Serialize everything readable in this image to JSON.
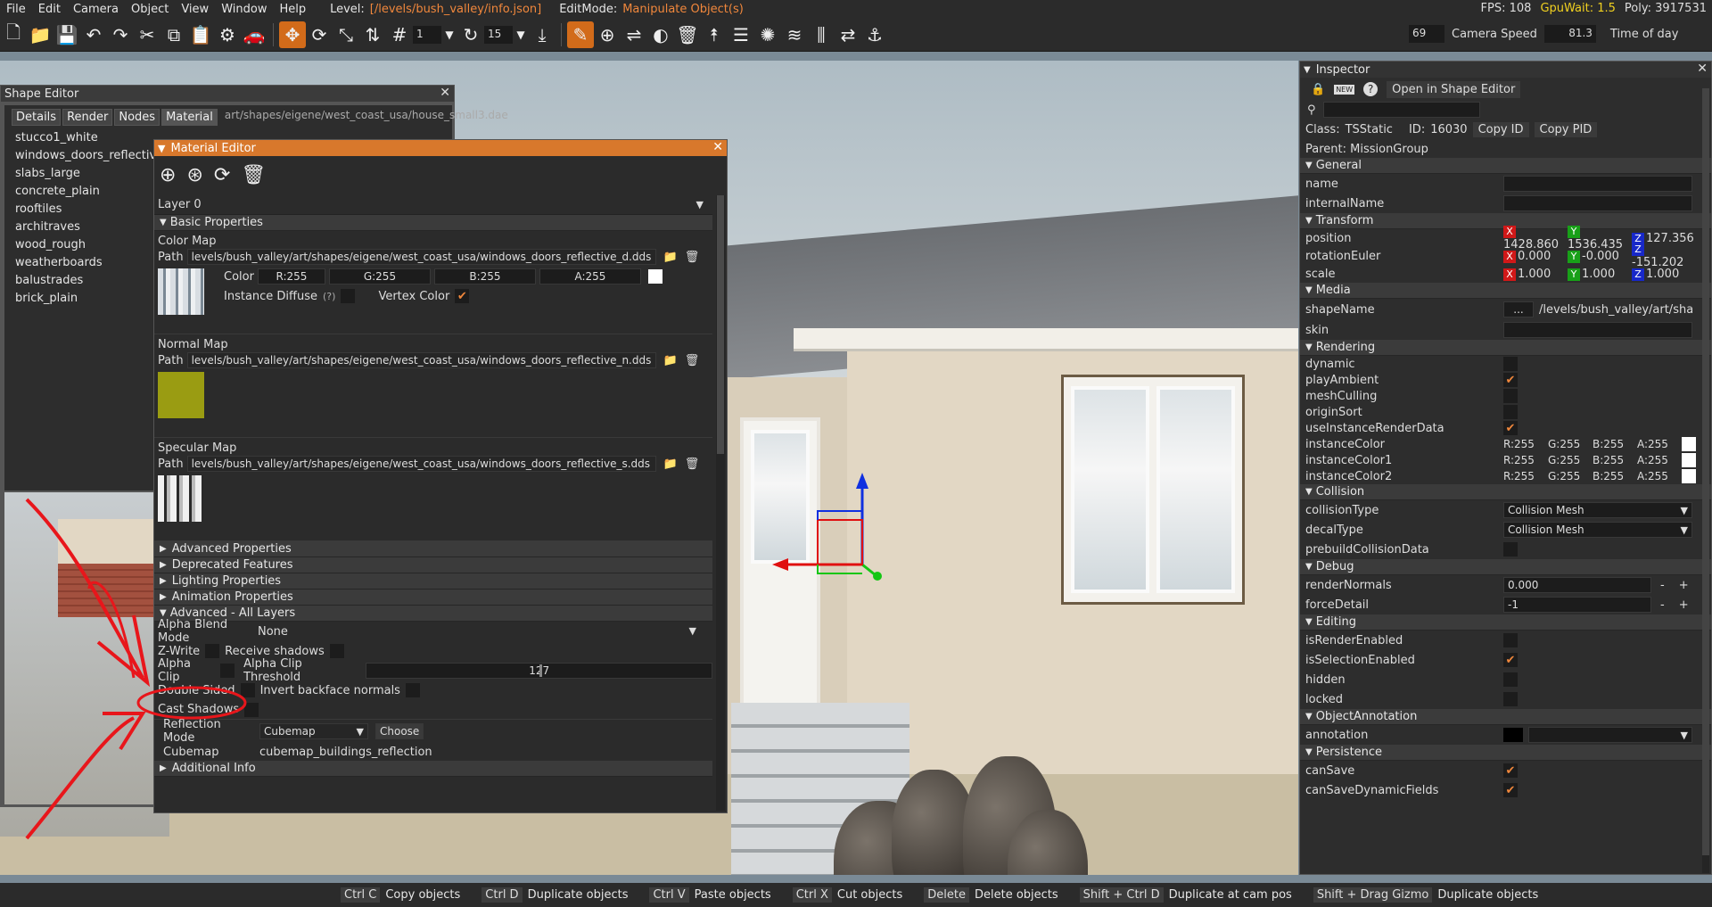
{
  "menubar": {
    "items": [
      "File",
      "Edit",
      "Camera",
      "Object",
      "View",
      "Window",
      "Help"
    ],
    "level_label": "Level:",
    "level_value": "[/levels/bush_valley/info.json]",
    "editmode_label": "EditMode:",
    "editmode_value": "Manipulate Object(s)",
    "fps": "FPS: 108",
    "gpuwait": "GpuWait: 1.5",
    "poly": "Poly: 3917531"
  },
  "toolbar": {
    "snap_value": "1",
    "rotate_value": "15",
    "fov_value": "69",
    "camera_speed_label": "Camera Speed",
    "camera_speed_value": "81.3",
    "time_of_day_label": "Time of day"
  },
  "shape_editor": {
    "title": "Shape Editor",
    "tabs": [
      "Details",
      "Render",
      "Nodes",
      "Material"
    ],
    "path": "art/shapes/eigene/west_coast_usa/house_small3.dae",
    "materials": [
      "stucco1_white",
      "windows_doors_reflective",
      "slabs_large",
      "concrete_plain",
      "rooftiles",
      "architraves",
      "wood_rough",
      "weatherboards",
      "balustrades",
      "brick_plain"
    ]
  },
  "material_editor": {
    "title": "Material Editor",
    "layer": "Layer 0",
    "basic_properties": "Basic Properties",
    "color_map": {
      "label": "Color Map",
      "path_label": "Path",
      "path": "levels/bush_valley/art/shapes/eigene/west_coast_usa/windows_doors_reflective_d.dds",
      "color_label": "Color",
      "r": "R:255",
      "g": "G:255",
      "b": "B:255",
      "a": "A:255",
      "instance_diffuse": "Instance Diffuse",
      "help": "(?)",
      "vertex_color": "Vertex Color"
    },
    "normal_map": {
      "label": "Normal Map",
      "path_label": "Path",
      "path": "levels/bush_valley/art/shapes/eigene/west_coast_usa/windows_doors_reflective_n.dds"
    },
    "specular_map": {
      "label": "Specular Map",
      "path_label": "Path",
      "path": "levels/bush_valley/art/shapes/eigene/west_coast_usa/windows_doors_reflective_s.dds"
    },
    "sections": [
      "Advanced Properties",
      "Deprecated Features",
      "Lighting Properties",
      "Animation Properties"
    ],
    "advanced_all_layers": "Advanced - All Layers",
    "alpha_blend_mode_label": "Alpha Blend Mode",
    "alpha_blend_mode_value": "None",
    "zwrite": "Z-Write",
    "receive_shadows": "Receive shadows",
    "alpha_clip": "Alpha Clip",
    "alpha_clip_threshold": "Alpha Clip Threshold",
    "alpha_clip_threshold_value": "127",
    "alpha_clip_threshold_level": 0.5,
    "double_sided": "Double Sided",
    "invert_backface": "Invert backface normals",
    "cast_shadows": "Cast Shadows",
    "reflection_mode_label": "Reflection Mode",
    "reflection_mode_value": "Cubemap",
    "choose": "Choose",
    "cubemap_label": "Cubemap",
    "cubemap_value": "cubemap_buildings_reflection",
    "additional_info": "Additional Info"
  },
  "inspector": {
    "title": "Inspector",
    "open_in_shape_editor": "Open in Shape Editor",
    "new_badge": "NEW",
    "class_label": "Class:",
    "class_value": "TSStatic",
    "id_label": "ID:",
    "id_value": "16030",
    "copy_id": "Copy ID",
    "copy_pid": "Copy PID",
    "parent": "Parent:  MissionGroup",
    "general": "General",
    "name": "name",
    "internal_name": "internalName",
    "transform": "Transform",
    "position": "position",
    "pos_x": "1428.860",
    "pos_y": "1536.435",
    "pos_z": "127.356",
    "rotation": "rotationEuler",
    "rot_x": "0.000",
    "rot_y": "-0.000",
    "rot_z": "-151.202",
    "scale": "scale",
    "scl_x": "1.000",
    "scl_y": "1.000",
    "scl_z": "1.000",
    "media": "Media",
    "shape_name": "shapeName",
    "shape_name_btn": "...",
    "shape_name_value": "/levels/bush_valley/art/shapes",
    "skin": "skin",
    "rendering": "Rendering",
    "render_fields": [
      {
        "label": "dynamic",
        "checked": false
      },
      {
        "label": "playAmbient",
        "checked": true
      },
      {
        "label": "meshCulling",
        "checked": false
      },
      {
        "label": "originSort",
        "checked": false
      },
      {
        "label": "useInstanceRenderData",
        "checked": true
      }
    ],
    "instance_colors": [
      "instanceColor",
      "instanceColor1",
      "instanceColor2"
    ],
    "ic_r": "R:255",
    "ic_g": "G:255",
    "ic_b": "B:255",
    "ic_a": "A:255",
    "collision": "Collision",
    "collision_type": "collisionType",
    "collision_type_value": "Collision Mesh",
    "decal_type": "decalType",
    "decal_type_value": "Collision Mesh",
    "prebuild": "prebuildCollisionData",
    "debug": "Debug",
    "render_normals": "renderNormals",
    "render_normals_value": "0.000",
    "force_detail": "forceDetail",
    "force_detail_value": "-1",
    "editing": "Editing",
    "editing_fields": [
      {
        "label": "isRenderEnabled",
        "checked": false
      },
      {
        "label": "isSelectionEnabled",
        "checked": true
      },
      {
        "label": "hidden",
        "checked": false
      },
      {
        "label": "locked",
        "checked": false
      }
    ],
    "object_annotation": "ObjectAnnotation",
    "annotation": "annotation",
    "persistence": "Persistence",
    "can_save": "canSave",
    "can_save_dynamic": "canSaveDynamicFields",
    "minus": "-",
    "plus": "+"
  },
  "statusbar": [
    {
      "key": "Ctrl C",
      "action": "Copy objects"
    },
    {
      "key": "Ctrl D",
      "action": "Duplicate objects"
    },
    {
      "key": "Ctrl V",
      "action": "Paste objects"
    },
    {
      "key": "Ctrl X",
      "action": "Cut objects"
    },
    {
      "key": "Delete",
      "action": "Delete objects"
    },
    {
      "key": "Shift + Ctrl D",
      "action": "Duplicate at cam pos"
    },
    {
      "key": "Shift + Drag Gizmo",
      "action": "Duplicate objects"
    }
  ],
  "colors": {
    "accent": "#d8782c",
    "panel": "#2f2f2f",
    "annotation_red": "#e8161b",
    "gizmo_red": "#e01010",
    "gizmo_green": "#14c614",
    "gizmo_blue": "#1030e0"
  }
}
